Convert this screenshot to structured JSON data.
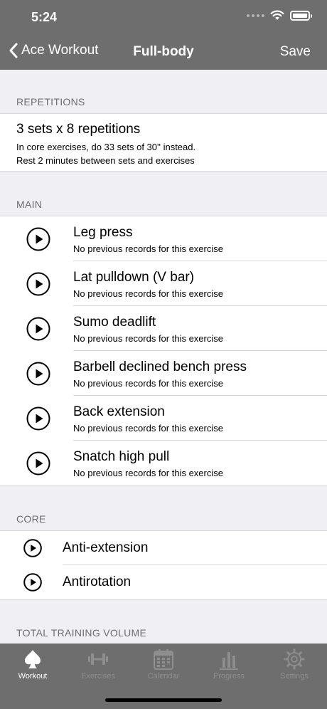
{
  "status": {
    "time": "5:24"
  },
  "nav": {
    "back_label": "Ace Workout",
    "title": "Full-body",
    "save_label": "Save"
  },
  "repetitions": {
    "header": "REPETITIONS",
    "title": "3 sets x 8 repetitions",
    "line1": "In core exercises, do 33 sets of 30'' instead.",
    "line2": "Rest 2 minutes between sets and exercises"
  },
  "main": {
    "header": "MAIN",
    "exercises": [
      {
        "name": "Leg press",
        "sub": "No previous records for this exercise"
      },
      {
        "name": "Lat pulldown (V bar)",
        "sub": "No previous records for this exercise"
      },
      {
        "name": "Sumo deadlift",
        "sub": "No previous records for this exercise"
      },
      {
        "name": "Barbell declined bench press",
        "sub": "No previous records for this exercise"
      },
      {
        "name": "Back extension",
        "sub": "No previous records for this exercise"
      },
      {
        "name": "Snatch high pull",
        "sub": "No previous records for this exercise"
      }
    ]
  },
  "core": {
    "header": "CORE",
    "exercises": [
      {
        "name": "Anti-extension"
      },
      {
        "name": "Antirotation"
      }
    ]
  },
  "volume": {
    "header": "TOTAL TRAINING VOLUME"
  },
  "tabs": [
    {
      "label": "Workout",
      "icon": "spade-icon",
      "active": true
    },
    {
      "label": "Exercises",
      "icon": "dumbbell-icon",
      "active": false
    },
    {
      "label": "Calendar",
      "icon": "calendar-icon",
      "active": false
    },
    {
      "label": "Progress",
      "icon": "bar-chart-icon",
      "active": false
    },
    {
      "label": "Settings",
      "icon": "gear-icon",
      "active": false
    }
  ],
  "colors": {
    "bar": "#6e6e6e",
    "background": "#efeff4",
    "active_tab": "#ffffff",
    "inactive_tab": "#8e8e8e"
  }
}
